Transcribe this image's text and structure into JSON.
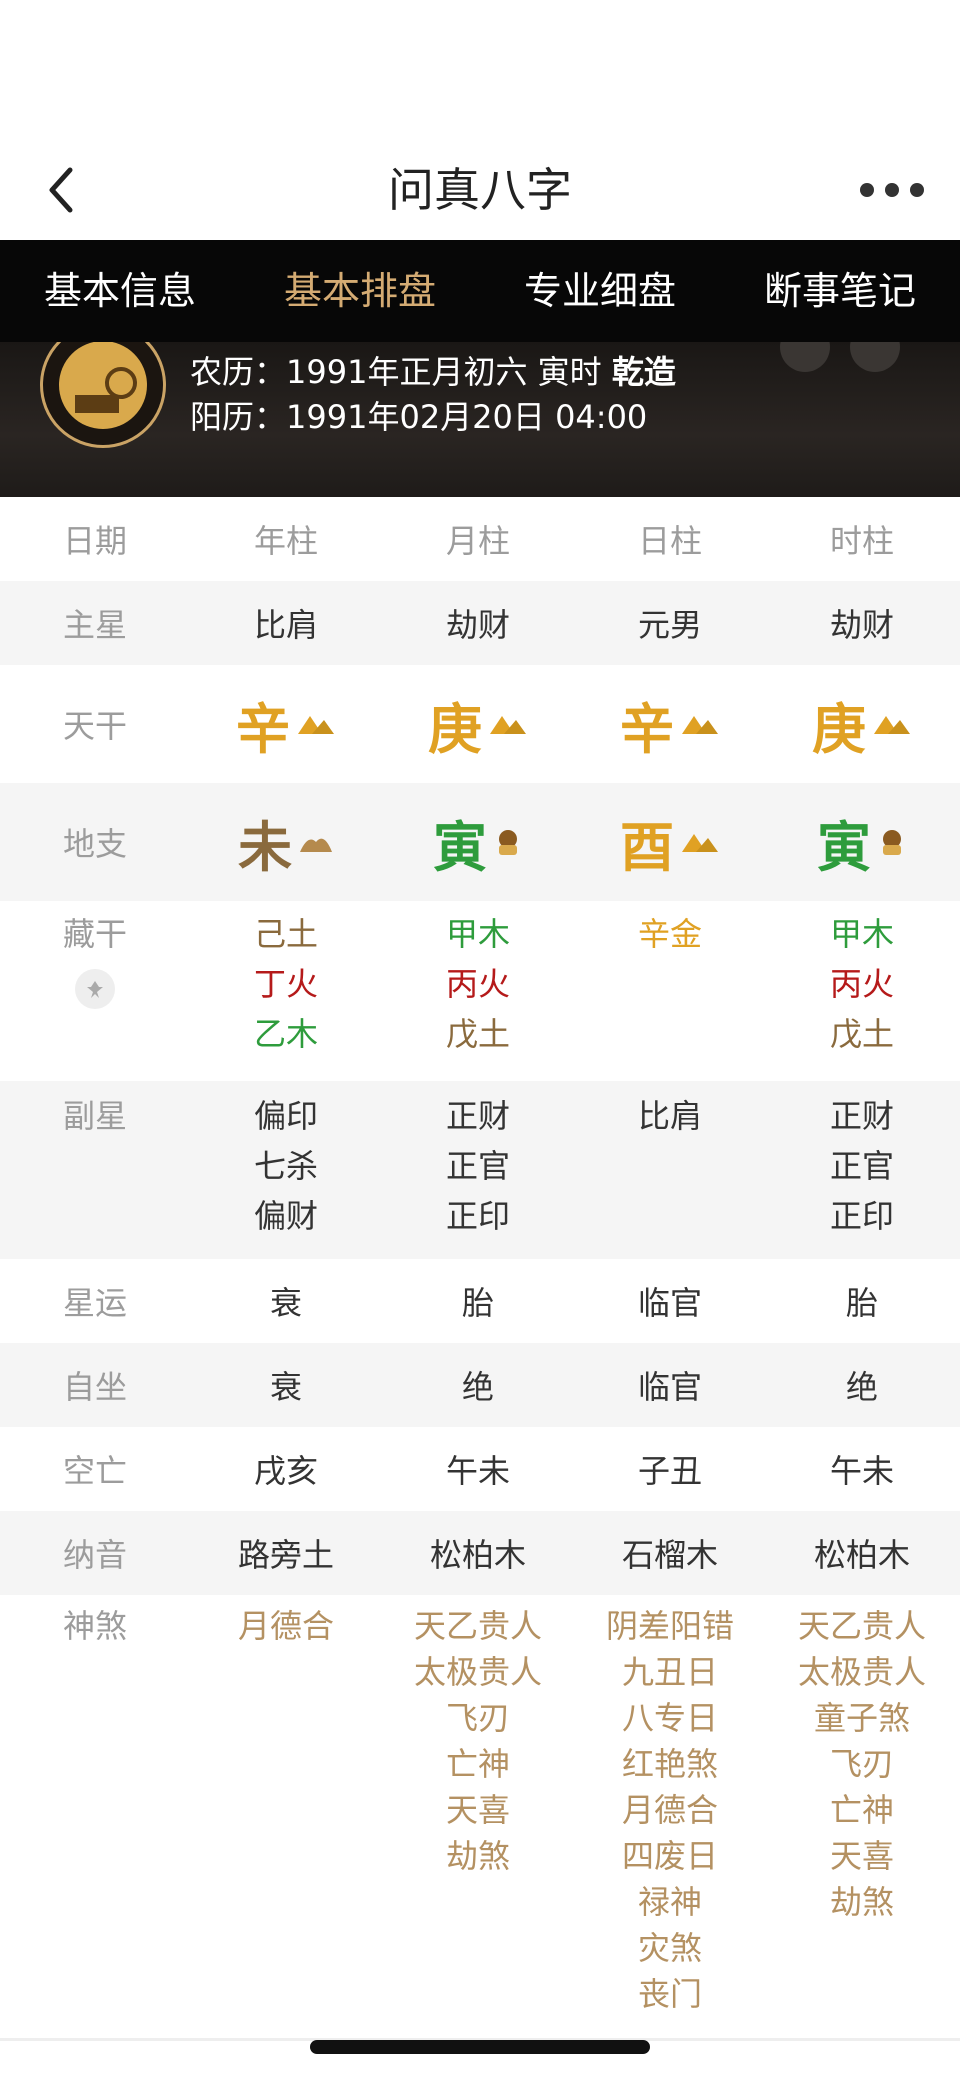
{
  "header": {
    "title": "问真八字"
  },
  "tabs": [
    {
      "label": "基本信息",
      "active": false
    },
    {
      "label": "基本排盘",
      "active": true
    },
    {
      "label": "专业细盘",
      "active": false
    },
    {
      "label": "断事笔记",
      "active": false
    }
  ],
  "profile": {
    "lunar_label": "农历：",
    "lunar_value": "1991年正月初六 寅时",
    "gender": "乾造",
    "solar_label": "阳历：",
    "solar_value": "1991年02月20日 04:00"
  },
  "columns": [
    "日期",
    "年柱",
    "月柱",
    "日柱",
    "时柱"
  ],
  "rows": {
    "zhuxing": {
      "label": "主星",
      "values": [
        "比肩",
        "劫财",
        "元男",
        "劫财"
      ]
    },
    "tiangan": {
      "label": "天干",
      "values": [
        "辛",
        "庚",
        "辛",
        "庚"
      ]
    },
    "dizhi": {
      "label": "地支",
      "values": [
        "未",
        "寅",
        "酉",
        "寅"
      ]
    },
    "canggan": {
      "label": "藏干",
      "values": [
        [
          "己土",
          "丁火",
          "乙木"
        ],
        [
          "甲木",
          "丙火",
          "戊土"
        ],
        [
          "辛金"
        ],
        [
          "甲木",
          "丙火",
          "戊土"
        ]
      ]
    },
    "fuxing": {
      "label": "副星",
      "values": [
        [
          "偏印",
          "七杀",
          "偏财"
        ],
        [
          "正财",
          "正官",
          "正印"
        ],
        [
          "比肩"
        ],
        [
          "正财",
          "正官",
          "正印"
        ]
      ]
    },
    "xingyun": {
      "label": "星运",
      "values": [
        "衰",
        "胎",
        "临官",
        "胎"
      ]
    },
    "zizuo": {
      "label": "自坐",
      "values": [
        "衰",
        "绝",
        "临官",
        "绝"
      ]
    },
    "kongwang": {
      "label": "空亡",
      "values": [
        "戌亥",
        "午未",
        "子丑",
        "午未"
      ]
    },
    "nayin": {
      "label": "纳音",
      "values": [
        "路旁土",
        "松柏木",
        "石榴木",
        "松柏木"
      ]
    },
    "shensha": {
      "label": "神煞",
      "values": [
        [
          "月德合"
        ],
        [
          "天乙贵人",
          "太极贵人",
          "飞刃",
          "亡神",
          "天喜",
          "劫煞"
        ],
        [
          "阴差阳错",
          "九丑日",
          "八专日",
          "红艳煞",
          "月德合",
          "四废日",
          "禄神",
          "灾煞",
          "丧门"
        ],
        [
          "天乙贵人",
          "太极贵人",
          "童子煞",
          "飞刃",
          "亡神",
          "天喜",
          "劫煞"
        ]
      ]
    }
  },
  "colors": {
    "gold": "#e0a123",
    "brown": "#8a6a3d",
    "green": "#2e9c3c",
    "red": "#b51a1a",
    "tan": "#b49162",
    "tab_active": "#d4ab73"
  }
}
